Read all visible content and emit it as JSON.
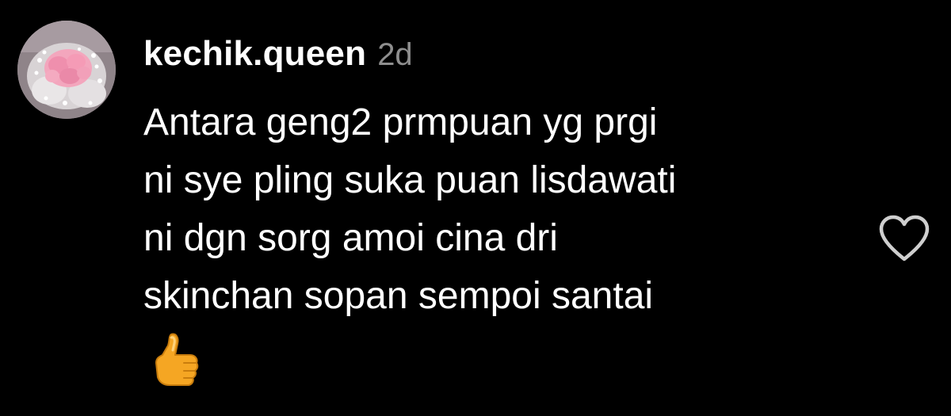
{
  "comment": {
    "username": "kechik.queen",
    "timestamp": "2d",
    "lines": [
      "Antara geng2 prmpuan yg prgi",
      "ni sye pling suka puan lisdawati",
      "ni dgn sorg amoi cina dri",
      "skinchan sopan sempoi santai"
    ],
    "emoji": "thumbs-up"
  },
  "like_button": {
    "icon": "heart-outline-icon",
    "liked": false
  },
  "colors": {
    "background": "#000000",
    "text": "#ffffff",
    "timestamp": "#8e8e8e",
    "icon": "#cfcfcf"
  }
}
